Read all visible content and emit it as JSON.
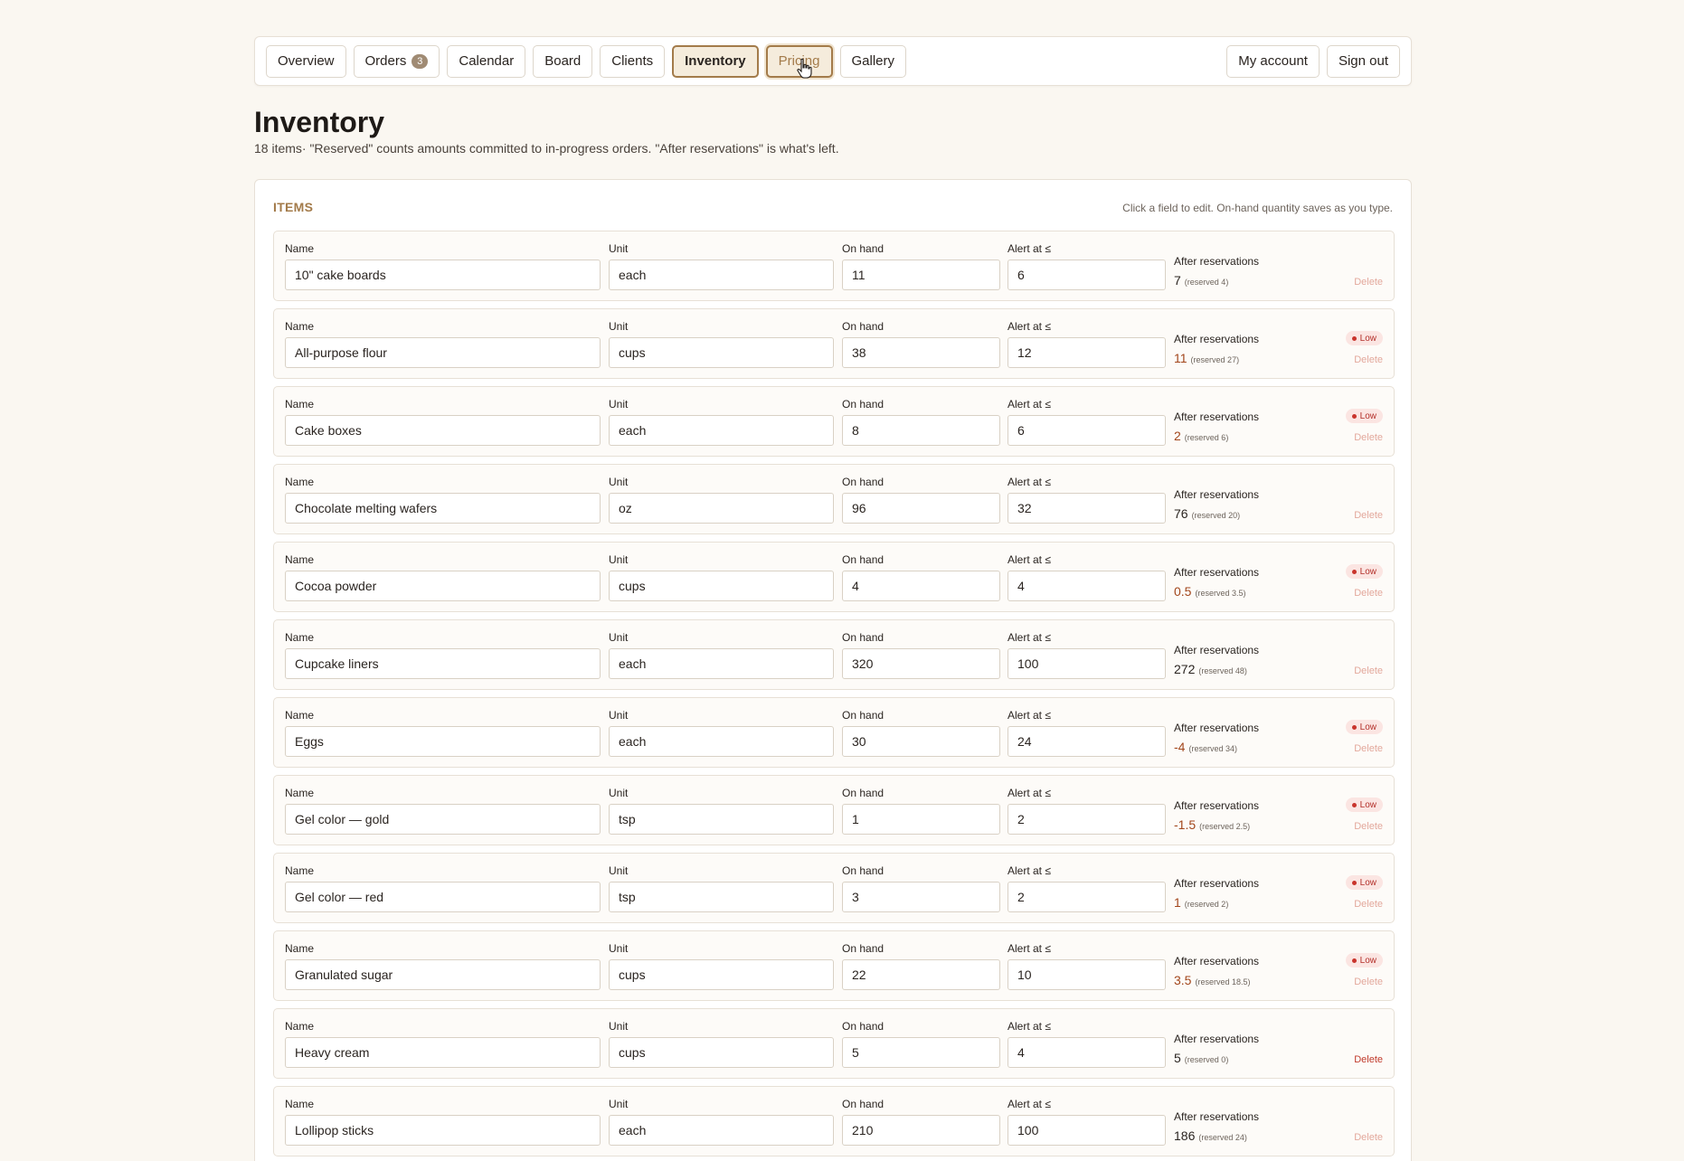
{
  "nav": {
    "tabs": [
      {
        "label": "Overview"
      },
      {
        "label": "Orders",
        "badge": "3"
      },
      {
        "label": "Calendar"
      },
      {
        "label": "Board"
      },
      {
        "label": "Clients"
      },
      {
        "label": "Inventory"
      },
      {
        "label": "Pricing"
      },
      {
        "label": "Gallery"
      }
    ],
    "right": [
      {
        "label": "My account"
      },
      {
        "label": "Sign out"
      }
    ]
  },
  "page": {
    "title": "Inventory",
    "subtitle": "18 items· \"Reserved\" counts amounts committed to in-progress orders. \"After reservations\" is what's left."
  },
  "panel": {
    "heading": "ITEMS",
    "hint": "Click a field to edit. On-hand quantity saves as you type."
  },
  "labels": {
    "name": "Name",
    "unit": "Unit",
    "on_hand": "On hand",
    "alert": "Alert at ≤",
    "after": "After reservations",
    "low": "Low",
    "delete": "Delete"
  },
  "items": [
    {
      "name": "10\" cake boards",
      "unit": "each",
      "on_hand": "11",
      "alert": "6",
      "after": "7",
      "reserved": "(reserved 4)",
      "low": false
    },
    {
      "name": "All-purpose flour",
      "unit": "cups",
      "on_hand": "38",
      "alert": "12",
      "after": "11",
      "reserved": "(reserved 27)",
      "low": true
    },
    {
      "name": "Cake boxes",
      "unit": "each",
      "on_hand": "8",
      "alert": "6",
      "after": "2",
      "reserved": "(reserved 6)",
      "low": true
    },
    {
      "name": "Chocolate melting wafers",
      "unit": "oz",
      "on_hand": "96",
      "alert": "32",
      "after": "76",
      "reserved": "(reserved 20)",
      "low": false
    },
    {
      "name": "Cocoa powder",
      "unit": "cups",
      "on_hand": "4",
      "alert": "4",
      "after": "0.5",
      "reserved": "(reserved 3.5)",
      "low": true
    },
    {
      "name": "Cupcake liners",
      "unit": "each",
      "on_hand": "320",
      "alert": "100",
      "after": "272",
      "reserved": "(reserved 48)",
      "low": false
    },
    {
      "name": "Eggs",
      "unit": "each",
      "on_hand": "30",
      "alert": "24",
      "after": "-4",
      "reserved": "(reserved 34)",
      "low": true
    },
    {
      "name": "Gel color — gold",
      "unit": "tsp",
      "on_hand": "1",
      "alert": "2",
      "after": "-1.5",
      "reserved": "(reserved 2.5)",
      "low": true
    },
    {
      "name": "Gel color — red",
      "unit": "tsp",
      "on_hand": "3",
      "alert": "2",
      "after": "1",
      "reserved": "(reserved 2)",
      "low": true
    },
    {
      "name": "Granulated sugar",
      "unit": "cups",
      "on_hand": "22",
      "alert": "10",
      "after": "3.5",
      "reserved": "(reserved 18.5)",
      "low": true
    },
    {
      "name": "Heavy cream",
      "unit": "cups",
      "on_hand": "5",
      "alert": "4",
      "after": "5",
      "reserved": "(reserved 0)",
      "low": false
    },
    {
      "name": "Lollipop sticks",
      "unit": "each",
      "on_hand": "210",
      "alert": "100",
      "after": "186",
      "reserved": "(reserved 24)",
      "low": false
    }
  ]
}
